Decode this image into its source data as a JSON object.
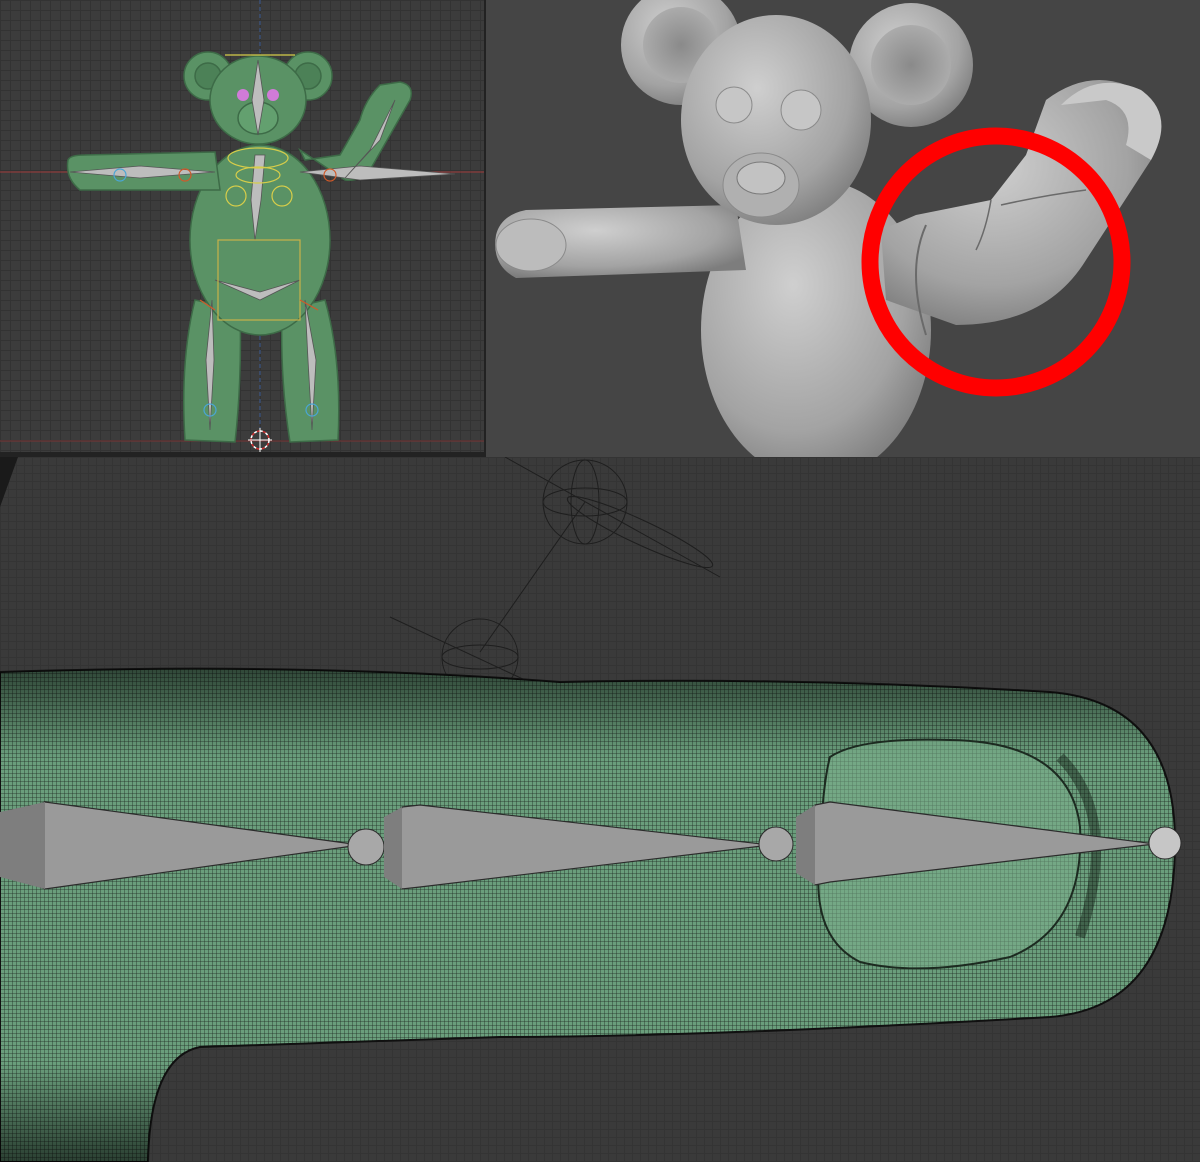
{
  "viewports": {
    "rig": {
      "label": "",
      "model_color": "#5a9265"
    },
    "render": {
      "label": "",
      "model_color": "#b8b8b8",
      "highlight_color": "#ff0000"
    },
    "closeup": {
      "label": "",
      "model_color": "#6aa07e",
      "bone_color": "#8e8e8e"
    }
  },
  "icons": {
    "cursor": "3d-cursor-icon",
    "highlight": "highlight-circle-icon"
  }
}
